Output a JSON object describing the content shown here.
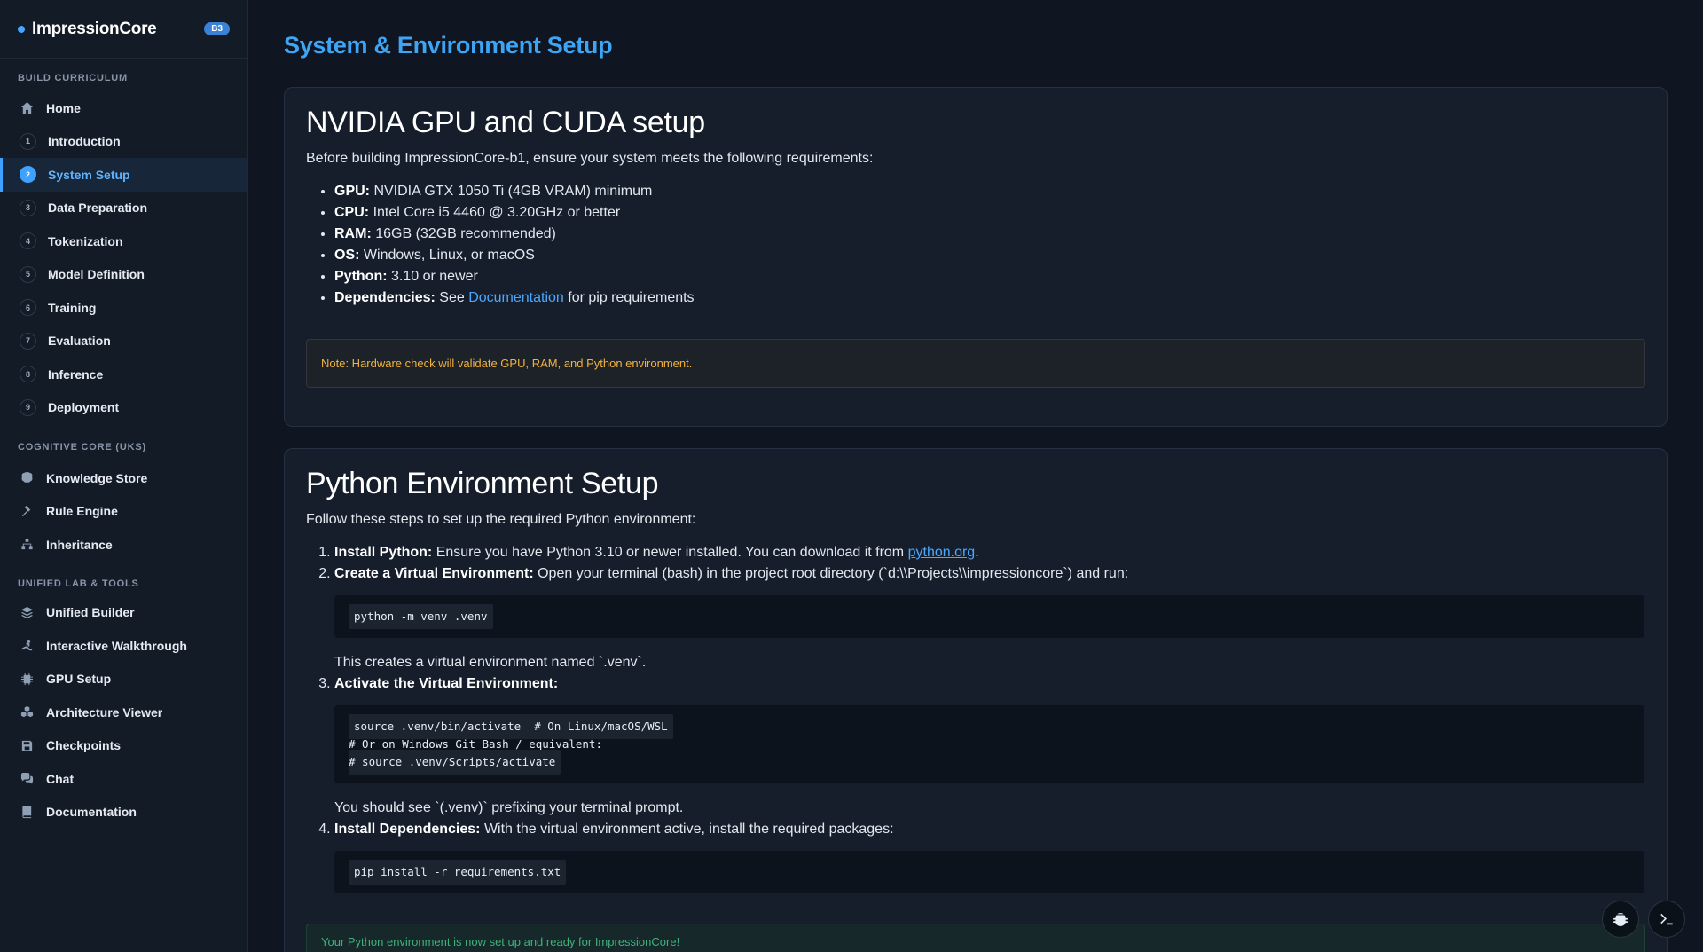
{
  "brand": {
    "name": "ImpressionCore",
    "badge": "B3"
  },
  "sidebar": {
    "sections": [
      {
        "title": "BUILD CURRICULUM"
      },
      {
        "title": "COGNITIVE CORE (UKS)"
      },
      {
        "title": "UNIFIED LAB & TOOLS"
      }
    ],
    "curriculum": [
      {
        "label": "Home",
        "icon": "home-icon"
      },
      {
        "num": "1",
        "label": "Introduction"
      },
      {
        "num": "2",
        "label": "System Setup",
        "active": true
      },
      {
        "num": "3",
        "label": "Data Preparation"
      },
      {
        "num": "4",
        "label": "Tokenization"
      },
      {
        "num": "5",
        "label": "Model Definition"
      },
      {
        "num": "6",
        "label": "Training"
      },
      {
        "num": "7",
        "label": "Evaluation"
      },
      {
        "num": "8",
        "label": "Inference"
      },
      {
        "num": "9",
        "label": "Deployment"
      }
    ],
    "cognitive": [
      {
        "label": "Knowledge Store",
        "icon": "brain-icon"
      },
      {
        "label": "Rule Engine",
        "icon": "gavel-icon"
      },
      {
        "label": "Inheritance",
        "icon": "hierarchy-icon"
      }
    ],
    "tools": [
      {
        "label": "Unified Builder",
        "icon": "layers-icon"
      },
      {
        "label": "Interactive Walkthrough",
        "icon": "walk-icon"
      },
      {
        "label": "GPU Setup",
        "icon": "chip-icon"
      },
      {
        "label": "Architecture Viewer",
        "icon": "cubes-icon"
      },
      {
        "label": "Checkpoints",
        "icon": "save-icon"
      },
      {
        "label": "Chat",
        "icon": "chat-icon"
      },
      {
        "label": "Documentation",
        "icon": "book-icon"
      }
    ]
  },
  "page": {
    "title": "System & Environment Setup"
  },
  "gpu_card": {
    "heading": "NVIDIA GPU and CUDA setup",
    "intro": "Before building ImpressionCore-b1, ensure your system meets the following requirements:",
    "requirements": [
      {
        "key": "GPU:",
        "value": "NVIDIA GTX 1050 Ti (4GB VRAM) minimum"
      },
      {
        "key": "CPU:",
        "value": "Intel Core i5 4460 @ 3.20GHz or better"
      },
      {
        "key": "RAM:",
        "value": "16GB (32GB recommended)"
      },
      {
        "key": "OS:",
        "value": "Windows, Linux, or macOS"
      },
      {
        "key": "Python:",
        "value": "3.10 or newer"
      }
    ],
    "deps": {
      "key": "Dependencies:",
      "pre": "See",
      "link": "Documentation",
      "post": "for pip requirements"
    },
    "note": "Note: Hardware check will validate GPU, RAM, and Python environment."
  },
  "python_card": {
    "heading": "Python Environment Setup",
    "intro": "Follow these steps to set up the required Python environment:",
    "step1": {
      "key": "Install Python:",
      "text": "Ensure you have Python 3.10 or newer installed. You can download it from",
      "link": "python.org",
      "end": "."
    },
    "step2": {
      "key": "Create a Virtual Environment:",
      "text": "Open your terminal (bash) in the project root directory (`d:\\\\Projects\\\\impressioncore`) and run:",
      "code": "python -m venv .venv",
      "after": "This creates a virtual environment named `.venv`."
    },
    "step3": {
      "key": "Activate the Virtual Environment:",
      "code": [
        "source .venv/bin/activate  # On Linux/macOS/WSL",
        "# Or on Windows Git Bash / equivalent:",
        "# source .venv/Scripts/activate"
      ],
      "after": "You should see `(.venv)` prefixing your terminal prompt."
    },
    "step4": {
      "key": "Install Dependencies:",
      "text": "With the virtual environment active, install the required packages:",
      "code": "pip install -r requirements.txt"
    },
    "success": "Your Python environment is now set up and ready for ImpressionCore!"
  },
  "fabs": {
    "debug": "bug-icon",
    "terminal": "terminal-icon"
  }
}
